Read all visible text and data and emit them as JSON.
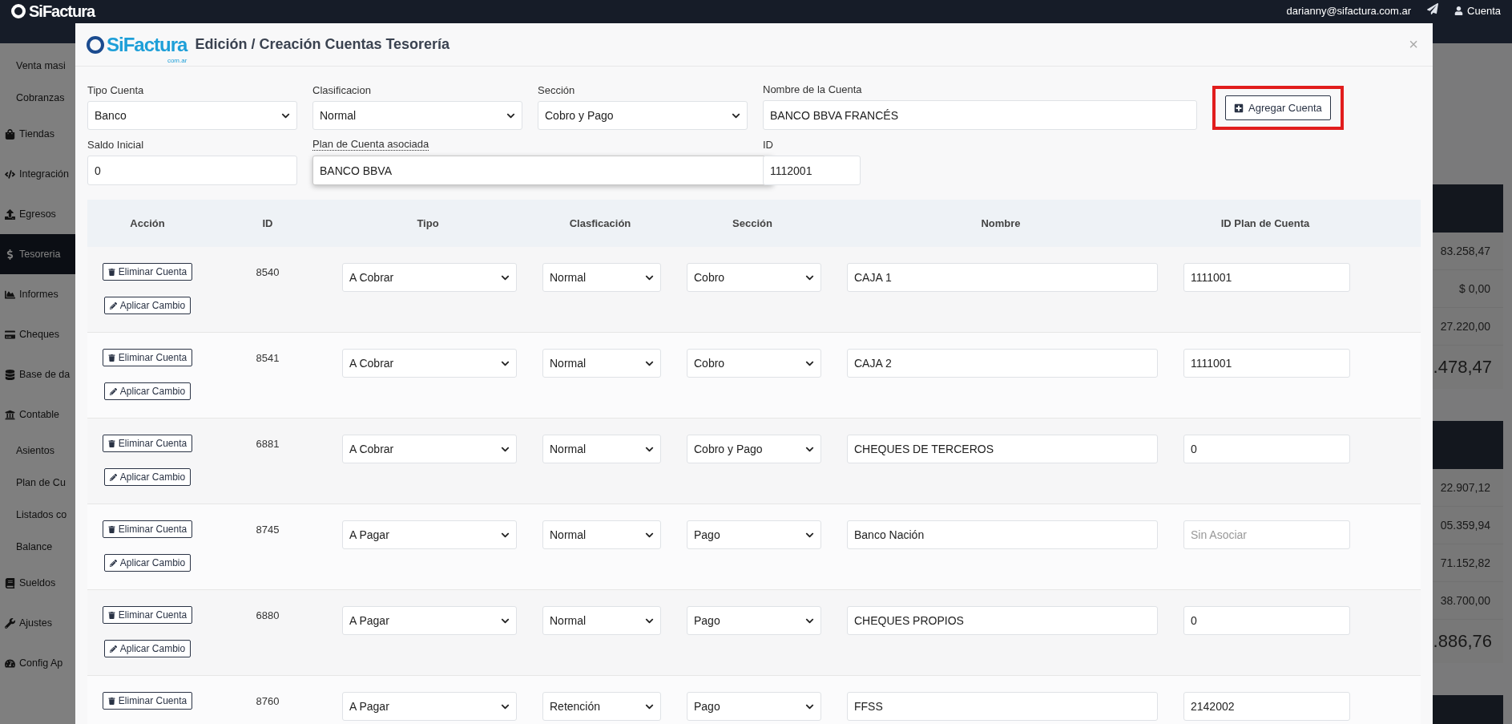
{
  "topbar": {
    "logo": "SiFactura",
    "email": "darianny@sifactura.com.ar",
    "account": "Cuenta"
  },
  "sidebar": {
    "items": [
      {
        "label": "Venta masi",
        "kind": "sub",
        "selected": false
      },
      {
        "label": "Cobranzas",
        "kind": "sub",
        "selected": false
      },
      {
        "label": "Tiendas",
        "kind": "main",
        "selected": false
      },
      {
        "label": "Integración",
        "kind": "main",
        "selected": false
      },
      {
        "label": "Egresos",
        "kind": "main",
        "selected": false
      },
      {
        "label": "Tesoreria",
        "kind": "main",
        "selected": true
      },
      {
        "label": "Informes",
        "kind": "main",
        "selected": false
      },
      {
        "label": "Cheques",
        "kind": "main",
        "selected": false
      },
      {
        "label": "Base de da",
        "kind": "main",
        "selected": false
      },
      {
        "label": "Contable",
        "kind": "main",
        "selected": false
      },
      {
        "label": "Asientos",
        "kind": "sub",
        "selected": false
      },
      {
        "label": "Plan de Cu",
        "kind": "sub",
        "selected": false
      },
      {
        "label": "Listados co",
        "kind": "sub",
        "selected": false
      },
      {
        "label": "Balance",
        "kind": "sub",
        "selected": false
      },
      {
        "label": "Sueldos",
        "kind": "main",
        "selected": false
      },
      {
        "label": "Ajustes",
        "kind": "main",
        "selected": false
      },
      {
        "label": "Config Ap",
        "kind": "main",
        "selected": false
      }
    ]
  },
  "background_cards": [
    {
      "rows": [
        "83.258,47",
        "$ 0,00",
        "27.220,00"
      ],
      "total": ".478,47"
    },
    {
      "rows": [
        "22.907,12",
        "05.359,94",
        "71.152,82",
        "38.700,00"
      ],
      "total": ".886,76"
    }
  ],
  "modal": {
    "logo": "SiFactura",
    "logo_sub": "com.ar",
    "title": "Edición / Creación Cuentas Tesorería",
    "close": "×",
    "form": {
      "rows": [
        [
          {
            "kind": "select",
            "label": "Tipo Cuenta",
            "value": "Banco"
          },
          {
            "kind": "select",
            "label": "Clasificacion",
            "value": "Normal"
          },
          {
            "kind": "select",
            "label": "Sección",
            "value": "Cobro y Pago"
          },
          {
            "kind": "input",
            "label": "Nombre de la Cuenta",
            "value": "BANCO BBVA FRANCÉS",
            "focused": false
          }
        ],
        [
          {
            "kind": "input",
            "label": "Saldo Inicial",
            "value": "0",
            "focused": false
          },
          {
            "kind": "input",
            "label": "Plan de Cuenta asociada",
            "value": "BANCO BBVA",
            "focused": true
          },
          "",
          {
            "kind": "input",
            "label": "ID",
            "value": "1112001",
            "focused": false
          }
        ]
      ],
      "button": {
        "label": "Agregar Cuenta",
        "highlighted": true
      }
    },
    "table": {
      "columns": [
        "Acción",
        "ID",
        "Tipo",
        "Clasficación",
        "Sección",
        "Nombre",
        "ID Plan de Cuenta"
      ],
      "rows": [
        {
          "actions": [
            "Eliminar Cuenta",
            "Aplicar Cambio"
          ],
          "id": "8540",
          "tipo": "A Cobrar",
          "clasificacion": "Normal",
          "seccion": "Cobro",
          "nombre": "CAJA 1",
          "plan_id": "1111001"
        },
        {
          "actions": [
            "Eliminar Cuenta",
            "Aplicar Cambio"
          ],
          "id": "8541",
          "tipo": "A Cobrar",
          "clasificacion": "Normal",
          "seccion": "Cobro",
          "nombre": "CAJA 2",
          "plan_id": "1111001"
        },
        {
          "actions": [
            "Eliminar Cuenta",
            "Aplicar Cambio"
          ],
          "id": "6881",
          "tipo": "A Cobrar",
          "clasificacion": "Normal",
          "seccion": "Cobro y Pago",
          "nombre": "CHEQUES DE TERCEROS",
          "plan_id": "0"
        },
        {
          "actions": [
            "Eliminar Cuenta",
            "Aplicar Cambio"
          ],
          "id": "8745",
          "tipo": "A Pagar",
          "clasificacion": "Normal",
          "seccion": "Pago",
          "nombre": "Banco Nación",
          "plan_placeholder": "Sin Asociar"
        },
        {
          "actions": [
            "Eliminar Cuenta",
            "Aplicar Cambio"
          ],
          "id": "6880",
          "tipo": "A Pagar",
          "clasificacion": "Normal",
          "seccion": "Pago",
          "nombre": "CHEQUES PROPIOS",
          "plan_id": "0"
        },
        {
          "actions": [
            "Eliminar Cuenta"
          ],
          "id": "8760",
          "tipo": "A Pagar",
          "clasificacion": "Retención",
          "seccion": "Pago",
          "nombre": "FFSS",
          "plan_id": "2142002"
        }
      ]
    }
  }
}
